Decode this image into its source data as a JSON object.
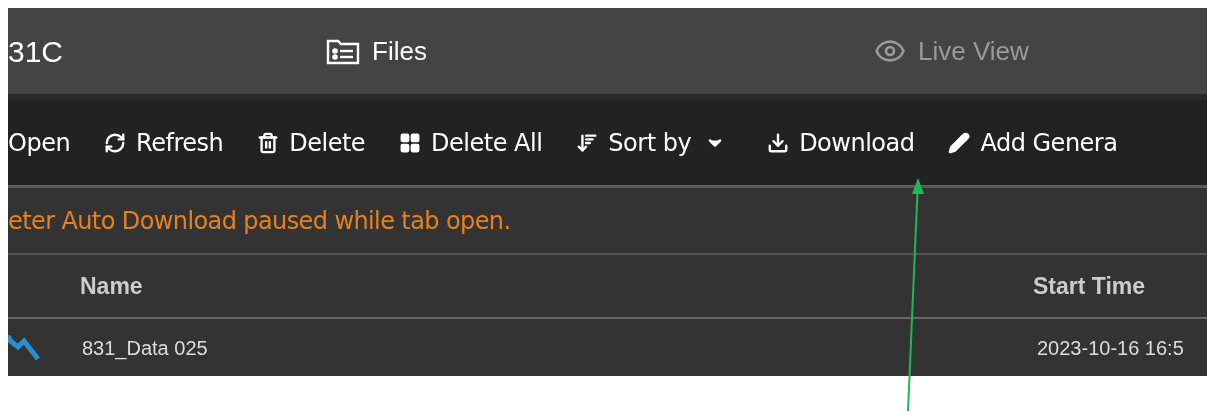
{
  "header": {
    "title": "31C",
    "tabs": [
      {
        "label": "Files",
        "selected": true
      },
      {
        "label": "Live View",
        "selected": false
      }
    ]
  },
  "toolbar": [
    "Open",
    "Refresh",
    "Delete",
    "Delete All",
    "Sort by",
    "Download",
    "Add Genera"
  ],
  "notice": "eter Auto Download paused while tab open.",
  "table": {
    "columns": [
      "Name",
      "Start Time"
    ],
    "rows": [
      [
        "831_Data 025",
        "2023-10-16 16:5"
      ]
    ]
  }
}
